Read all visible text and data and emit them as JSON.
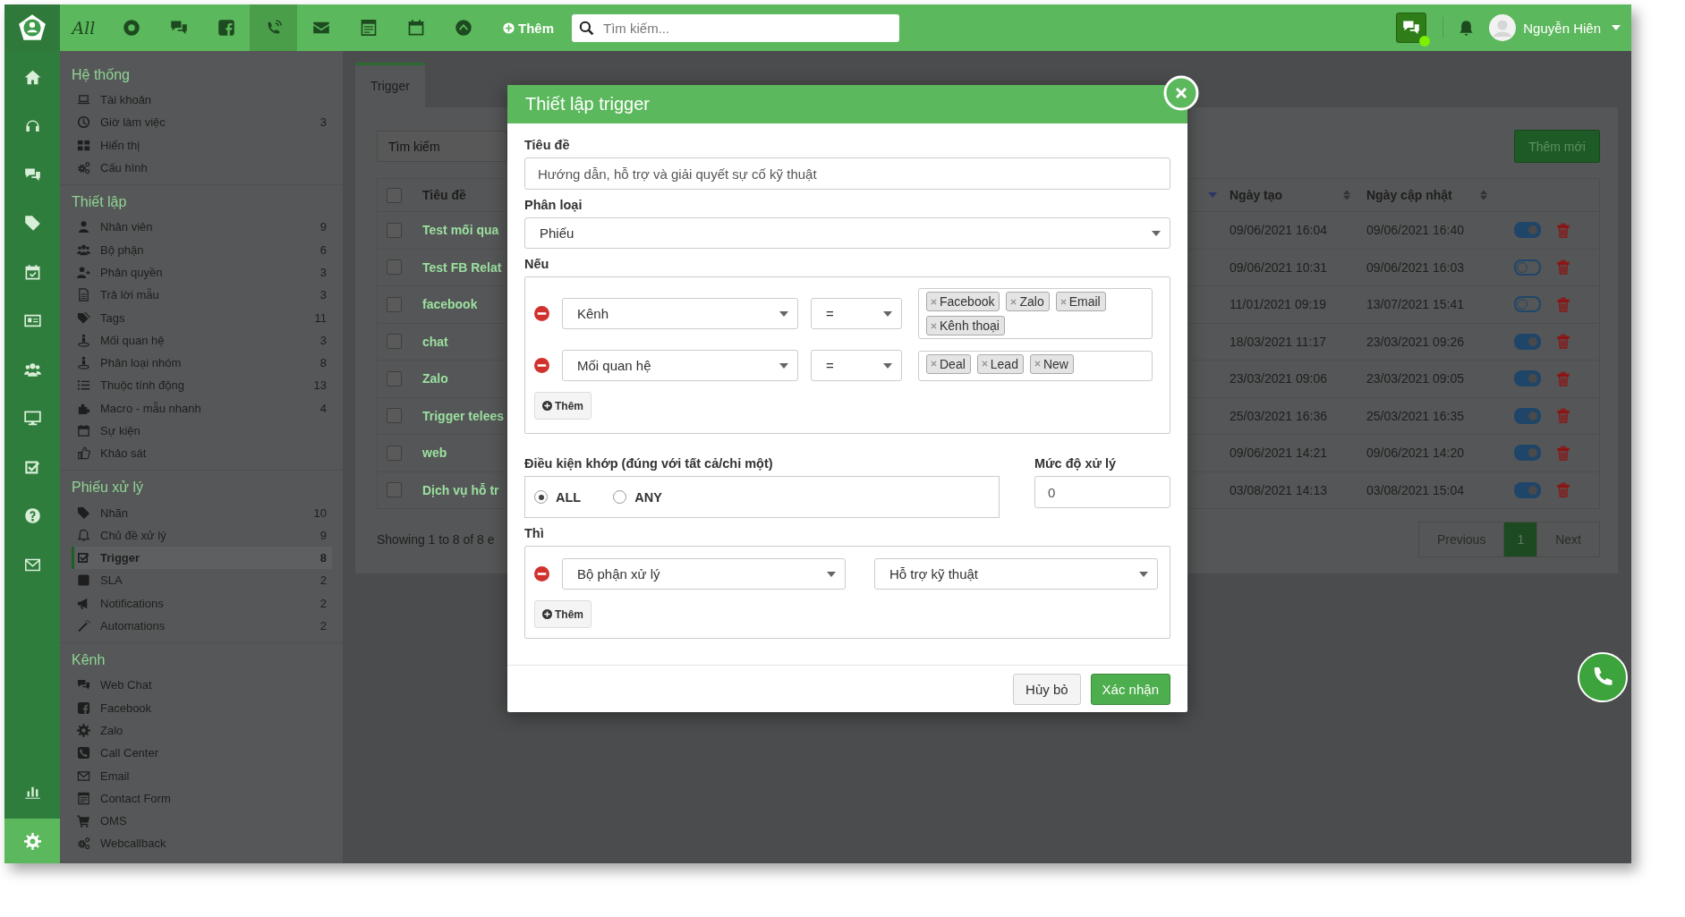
{
  "topbar": {
    "nav": [
      {
        "kind": "text",
        "label": "All",
        "selected": false
      },
      {
        "kind": "ring",
        "selected": false
      },
      {
        "kind": "chat",
        "selected": false
      },
      {
        "kind": "facebook",
        "selected": false
      },
      {
        "kind": "phone",
        "selected": true
      },
      {
        "kind": "mail",
        "selected": false
      },
      {
        "kind": "form",
        "selected": false
      },
      {
        "kind": "calendar",
        "selected": false
      },
      {
        "kind": "chevron-circle",
        "selected": false
      }
    ],
    "add_button": "Thêm",
    "search": {
      "placeholder": "Tìm kiếm..."
    },
    "user": {
      "name": "Nguyễn Hiên"
    }
  },
  "rail": {
    "items": [
      {
        "kind": "home",
        "selected": false
      },
      {
        "kind": "headset",
        "selected": false
      },
      {
        "kind": "chat",
        "selected": false
      },
      {
        "kind": "tag",
        "selected": false
      },
      {
        "kind": "calendar-check",
        "selected": false
      },
      {
        "kind": "id-card",
        "selected": false
      },
      {
        "kind": "users",
        "selected": false
      },
      {
        "kind": "monitor",
        "selected": false
      },
      {
        "kind": "check-square",
        "selected": false
      },
      {
        "kind": "question",
        "selected": false
      },
      {
        "kind": "mail",
        "selected": false
      }
    ],
    "bottom_items": [
      {
        "kind": "chart",
        "selected": false
      },
      {
        "kind": "gear",
        "selected": true
      }
    ]
  },
  "sidebar": {
    "sections": [
      {
        "title": "Hệ thống",
        "items": [
          {
            "label": "Tài khoản",
            "selected": false
          },
          {
            "label": "Giờ làm việc",
            "count": "3",
            "selected": false
          },
          {
            "label": "Hiển thị",
            "selected": false
          },
          {
            "label": "Cấu hình",
            "selected": false
          }
        ]
      },
      {
        "title": "Thiết lập",
        "items": [
          {
            "label": "Nhân viên",
            "count": "9",
            "selected": false
          },
          {
            "label": "Bộ phận",
            "count": "6",
            "selected": false
          },
          {
            "label": "Phân quyền",
            "count": "3",
            "selected": false
          },
          {
            "label": "Trả lời mẫu",
            "count": "3",
            "selected": false
          },
          {
            "label": "Tags",
            "count": "11",
            "selected": false
          },
          {
            "label": "Mối quan hệ",
            "count": "3",
            "selected": false
          },
          {
            "label": "Phân loại nhóm",
            "count": "8",
            "selected": false
          },
          {
            "label": "Thuộc tính động",
            "count": "13",
            "selected": false
          },
          {
            "label": "Macro - mẫu nhanh",
            "count": "4",
            "selected": false
          },
          {
            "label": "Sự kiện",
            "selected": false
          },
          {
            "label": "Khảo sát",
            "selected": false
          }
        ]
      },
      {
        "title": "Phiếu xử lý",
        "items": [
          {
            "label": "Nhãn",
            "count": "10",
            "selected": false
          },
          {
            "label": "Chủ đề xử lý",
            "count": "9",
            "selected": false
          },
          {
            "label": "Trigger",
            "count": "8",
            "selected": true
          },
          {
            "label": "SLA",
            "count": "2",
            "selected": false
          },
          {
            "label": "Notifications",
            "count": "2",
            "selected": false
          },
          {
            "label": "Automations",
            "count": "2",
            "selected": false
          }
        ]
      },
      {
        "title": "Kênh",
        "items": [
          {
            "label": "Web Chat",
            "selected": false
          },
          {
            "label": "Facebook",
            "selected": false
          },
          {
            "label": "Zalo",
            "selected": false
          },
          {
            "label": "Call Center",
            "selected": false
          },
          {
            "label": "Email",
            "selected": false
          },
          {
            "label": "Contact Form",
            "selected": false
          },
          {
            "label": "OMS",
            "selected": false
          },
          {
            "label": "Webcallback",
            "selected": false
          }
        ]
      }
    ]
  },
  "tabs": [
    {
      "label": "Trigger",
      "selected": true
    }
  ],
  "table_search": {
    "placeholder": "Tìm kiếm"
  },
  "add_new_button": "Thêm mới",
  "table": {
    "columns": [
      "Tiêu đề",
      "Ngày tạo",
      "Ngày cập nhật"
    ],
    "all_checked": false,
    "rows": [
      {
        "checked": false,
        "title": "Test mối qua",
        "created": "09/06/2021 16:04",
        "updated": "09/06/2021 16:40",
        "enabled": true
      },
      {
        "checked": false,
        "title": "Test FB Relat",
        "created": "09/06/2021 10:31",
        "updated": "09/06/2021 16:03",
        "enabled": false
      },
      {
        "checked": false,
        "title": "facebook",
        "created": "11/01/2021 09:19",
        "updated": "13/07/2021 15:41",
        "enabled": false
      },
      {
        "checked": false,
        "title": "chat",
        "created": "18/03/2021 11:17",
        "updated": "23/03/2021 09:26",
        "enabled": true
      },
      {
        "checked": false,
        "title": "Zalo",
        "created": "23/03/2021 09:06",
        "updated": "23/03/2021 09:05",
        "enabled": true
      },
      {
        "checked": false,
        "title": "Trigger telees",
        "created": "25/03/2021 16:36",
        "updated": "25/03/2021 16:35",
        "enabled": true
      },
      {
        "checked": false,
        "title": "web",
        "created": "09/06/2021 14:21",
        "updated": "09/06/2021 14:20",
        "enabled": true
      },
      {
        "checked": false,
        "title": "Dịch vụ hỗ tr",
        "created": "03/08/2021 14:13",
        "updated": "03/08/2021 15:04",
        "enabled": true
      }
    ]
  },
  "table_info": "Showing 1 to 8 of 8 e",
  "pagination": [
    {
      "label": "Previous",
      "selected": false
    },
    {
      "label": "1",
      "selected": true
    },
    {
      "label": "Next",
      "selected": false
    }
  ],
  "modal": {
    "title": "Thiết lập trigger",
    "title_label": "Tiêu đề",
    "title_value": "Hướng dẫn, hỗ trợ và giải quyết sự cố kỹ thuật",
    "category_label": "Phân loại",
    "category_value": "Phiếu",
    "if_label": "Nếu",
    "conditions": [
      {
        "field": "Kênh",
        "operator": "=",
        "tags": [
          "Facebook",
          "Zalo",
          "Email",
          "Kênh thoại"
        ]
      },
      {
        "field": "Mối quan hệ",
        "operator": "=",
        "tags": [
          "Deal",
          "Lead",
          "New"
        ]
      }
    ],
    "add_condition": "Thêm",
    "match_label": "Điều kiện khớp (đúng với tất cả/chỉ một)",
    "match_options": [
      {
        "label": "ALL",
        "selected": true
      },
      {
        "label": "ANY",
        "selected": false
      }
    ],
    "priority_label": "Mức độ xử lý",
    "priority_value": "0",
    "then_label": "Thì",
    "actions": [
      {
        "field": "Bộ phận xử lý",
        "value": "Hỗ trợ kỹ thuật"
      }
    ],
    "add_action": "Thêm",
    "cancel": "Hủy bỏ",
    "confirm": "Xác nhận"
  }
}
